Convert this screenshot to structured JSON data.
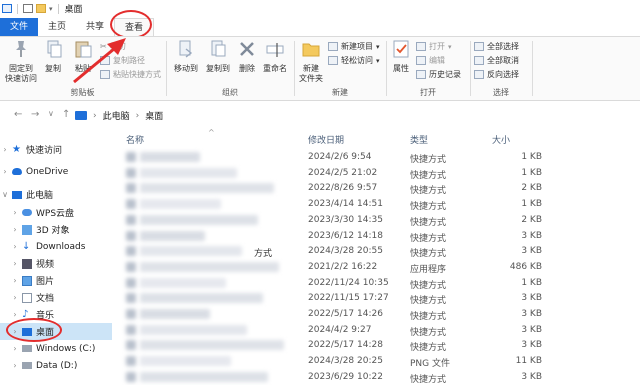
{
  "window": {
    "title": "桌面"
  },
  "tabs": [
    {
      "label": "文件"
    },
    {
      "label": "主页"
    },
    {
      "label": "共享"
    },
    {
      "label": "查看"
    }
  ],
  "ribbon": {
    "clipboard": {
      "pin_label_1": "固定到",
      "pin_label_2": "快速访问",
      "copy": "复制",
      "paste": "粘贴",
      "cut": "剪切",
      "copy_path": "复制路径",
      "paste_shortcut": "粘贴快捷方式",
      "group": "剪贴板"
    },
    "organize": {
      "move_to": "移动到",
      "copy_to": "复制到",
      "delete": "删除",
      "rename": "重命名",
      "group": "组织"
    },
    "new": {
      "new_folder_1": "新建",
      "new_folder_2": "文件夹",
      "new_item": "新建项目",
      "easy_access": "轻松访问",
      "group": "新建"
    },
    "open": {
      "properties": "属性",
      "open": "打开",
      "edit": "编辑",
      "history": "历史记录",
      "group": "打开"
    },
    "select": {
      "select_all": "全部选择",
      "select_none": "全部取消",
      "invert": "反向选择",
      "group": "选择"
    }
  },
  "address": {
    "path": [
      "此电脑",
      "桌面"
    ]
  },
  "sidebar": [
    {
      "label": "快速访问"
    },
    {
      "label": "OneDrive"
    },
    {
      "label": "此电脑"
    },
    {
      "label": "WPS云盘"
    },
    {
      "label": "3D 对象"
    },
    {
      "label": "Downloads"
    },
    {
      "label": "视频"
    },
    {
      "label": "图片"
    },
    {
      "label": "文档"
    },
    {
      "label": "音乐"
    },
    {
      "label": "桌面"
    },
    {
      "label": "Windows (C:)"
    },
    {
      "label": "Data (D:)"
    }
  ],
  "columns": {
    "name": "名称",
    "modified": "修改日期",
    "type": "类型",
    "size": "大小"
  },
  "partial_text": "方式",
  "files": [
    {
      "date": "2024/2/6 9:54",
      "type": "快捷方式",
      "size": "1 KB"
    },
    {
      "date": "2024/2/5 21:02",
      "type": "快捷方式",
      "size": "1 KB"
    },
    {
      "date": "2022/8/26 9:57",
      "type": "快捷方式",
      "size": "2 KB"
    },
    {
      "date": "2023/4/14 14:51",
      "type": "快捷方式",
      "size": "1 KB"
    },
    {
      "date": "2023/3/30 14:35",
      "type": "快捷方式",
      "size": "2 KB"
    },
    {
      "date": "2023/6/12 14:18",
      "type": "快捷方式",
      "size": "3 KB"
    },
    {
      "date": "2024/3/28 20:55",
      "type": "快捷方式",
      "size": "3 KB"
    },
    {
      "date": "2021/2/2 16:22",
      "type": "应用程序",
      "size": "486 KB"
    },
    {
      "date": "2022/11/24 10:35",
      "type": "快捷方式",
      "size": "1 KB"
    },
    {
      "date": "2022/11/15 17:27",
      "type": "快捷方式",
      "size": "3 KB"
    },
    {
      "date": "2022/5/17 14:26",
      "type": "快捷方式",
      "size": "3 KB"
    },
    {
      "date": "2024/4/2 9:27",
      "type": "快捷方式",
      "size": "3 KB"
    },
    {
      "date": "2022/5/17 14:28",
      "type": "快捷方式",
      "size": "3 KB"
    },
    {
      "date": "2024/3/28 20:25",
      "type": "PNG 文件",
      "size": "11 KB"
    },
    {
      "date": "2023/6/29 10:22",
      "type": "快捷方式",
      "size": "3 KB"
    }
  ]
}
